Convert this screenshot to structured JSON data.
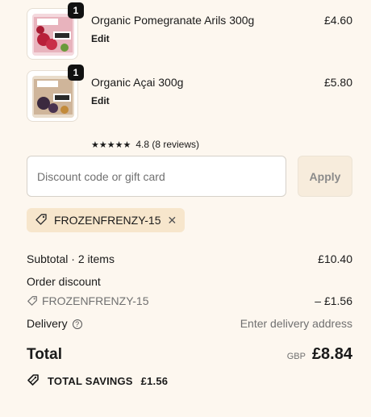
{
  "items": [
    {
      "name": "Organic Pomegranate Arils 300g",
      "quantity": "1",
      "edit_label": "Edit",
      "price": "£4.60",
      "thumb_colors": [
        "#c2334a",
        "#e9a0ae"
      ]
    },
    {
      "name": "Organic Açai 300g",
      "quantity": "1",
      "edit_label": "Edit",
      "price": "£5.80",
      "rating_stars": "★★★★★",
      "rating_text": "4.8 (8 reviews)",
      "thumb_colors": [
        "#3b2a3f",
        "#cfb59a"
      ]
    }
  ],
  "discount": {
    "placeholder": "Discount code or gift card",
    "apply_label": "Apply",
    "applied_code": "FROZENFRENZY-15"
  },
  "summary": {
    "subtotal_label": "Subtotal · 2 items",
    "subtotal_value": "£10.40",
    "order_discount_label": "Order discount",
    "discount_code": "FROZENFRENZY-15",
    "discount_value": "– £1.56",
    "delivery_label": "Delivery",
    "delivery_value": "Enter delivery address",
    "total_label": "Total",
    "currency": "GBP",
    "total_value": "£8.84",
    "savings_label": "TOTAL SAVINGS",
    "savings_value": "£1.56"
  },
  "colors": {
    "background": "#fdf7ef",
    "chip": "#f7e6cc",
    "apply_button": "#f7ecdc"
  }
}
